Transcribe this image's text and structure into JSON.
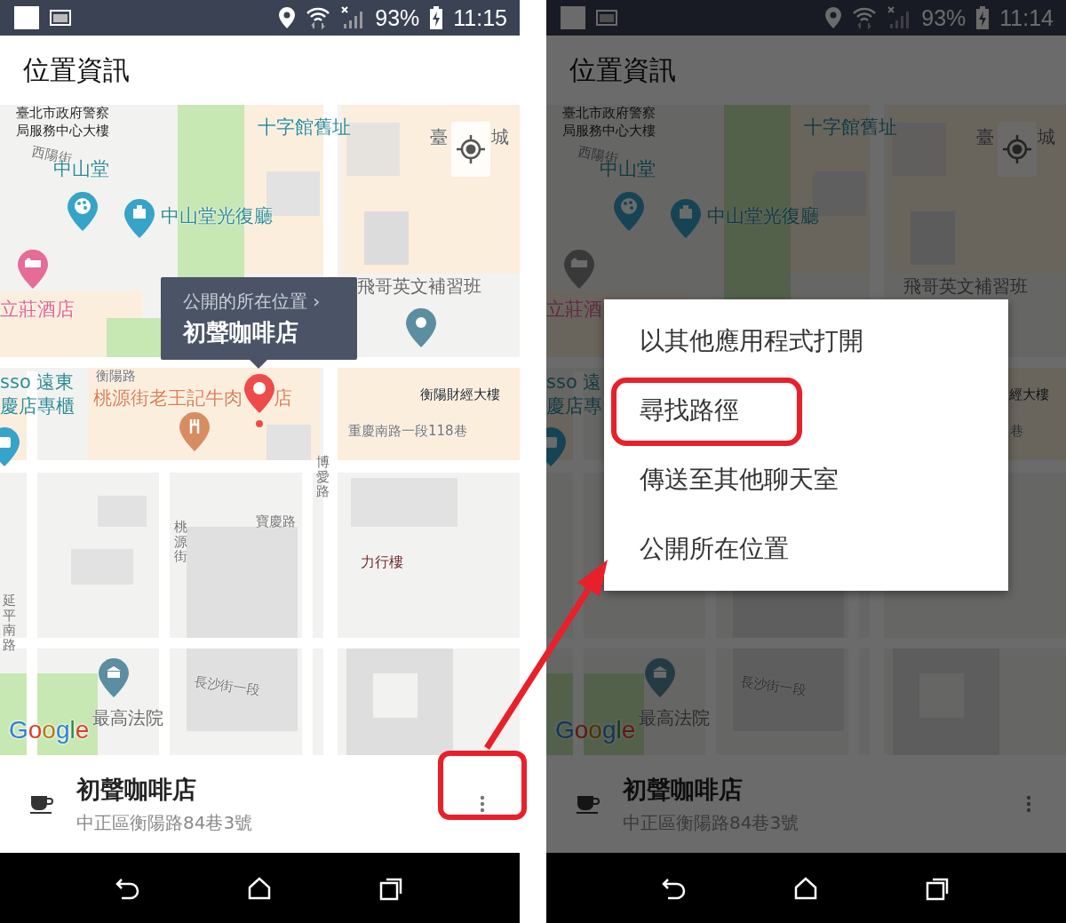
{
  "screens": [
    {
      "dimmed": false,
      "status_bar": {
        "battery": "93%",
        "time": "11:15"
      },
      "title": "位置資訊",
      "map": {
        "labels": [
          {
            "text": "臺北市政府警察",
            "kind": "building"
          },
          {
            "text": "局服務中心大樓",
            "kind": "building"
          },
          {
            "text": "十字館舊址",
            "kind": "attraction"
          },
          {
            "text": "臺",
            "kind": "business"
          },
          {
            "text": "城",
            "kind": "business"
          },
          {
            "text": "西陽街",
            "kind": "street"
          },
          {
            "text": "中山堂",
            "kind": "attraction"
          },
          {
            "text": "中山堂光復廳",
            "kind": "attraction"
          },
          {
            "text": "立莊酒店",
            "kind": "hotel"
          },
          {
            "text": "飛哥英文補習班",
            "kind": "business"
          },
          {
            "text": "sso 遠東",
            "kind": "attraction"
          },
          {
            "text": "慶店專櫃",
            "kind": "attraction"
          },
          {
            "text": "衡陽路",
            "kind": "street"
          },
          {
            "text": "桃源街老王記牛肉",
            "kind": "restaurant"
          },
          {
            "text": "店",
            "kind": "restaurant"
          },
          {
            "text": "衡陽財經大樓",
            "kind": "building"
          },
          {
            "text": "重慶南路一段118巷",
            "kind": "street"
          },
          {
            "text": "博愛路",
            "kind": "street-vertical"
          },
          {
            "text": "寶慶路",
            "kind": "street"
          },
          {
            "text": "桃源街",
            "kind": "street-vertical"
          },
          {
            "text": "力行樓",
            "kind": "campus"
          },
          {
            "text": "延平南路",
            "kind": "street-vertical"
          },
          {
            "text": "長沙街一段",
            "kind": "street"
          },
          {
            "text": "最高法院",
            "kind": "business"
          }
        ],
        "callout": {
          "caption": "公開的所在位置 ›",
          "name": "初聲咖啡店"
        },
        "attribution": "Google"
      },
      "place": {
        "name": "初聲咖啡店",
        "address": "中正區衡陽路84巷3號"
      }
    },
    {
      "dimmed": true,
      "status_bar": {
        "battery": "93%",
        "time": "11:14"
      },
      "title": "位置資訊",
      "map": {
        "labels": [
          {
            "text": "臺北市政府警察",
            "kind": "building"
          },
          {
            "text": "局服務中心大樓",
            "kind": "building"
          },
          {
            "text": "十字館舊址",
            "kind": "attraction"
          },
          {
            "text": "臺",
            "kind": "business"
          },
          {
            "text": "城",
            "kind": "business"
          },
          {
            "text": "西陽街",
            "kind": "street"
          },
          {
            "text": "中山堂",
            "kind": "attraction"
          },
          {
            "text": "中山堂光復廳",
            "kind": "attraction"
          },
          {
            "text": "立莊酒",
            "kind": "hotel"
          },
          {
            "text": "飛哥英文補習班",
            "kind": "business"
          },
          {
            "text": "sso 遠",
            "kind": "attraction"
          },
          {
            "text": "慶店專",
            "kind": "attraction"
          },
          {
            "text": "經大樓",
            "kind": "building"
          },
          {
            "text": "巷",
            "kind": "street"
          },
          {
            "text": "長沙街一段",
            "kind": "street"
          },
          {
            "text": "最高法院",
            "kind": "business"
          }
        ],
        "attribution": "Google"
      },
      "place": {
        "name": "初聲咖啡店",
        "address": "中正區衡陽路84巷3號"
      },
      "menu": {
        "items": [
          "以其他應用程式打開",
          "尋找路徑",
          "傳送至其他聊天室",
          "公開所在位置"
        ]
      }
    }
  ]
}
